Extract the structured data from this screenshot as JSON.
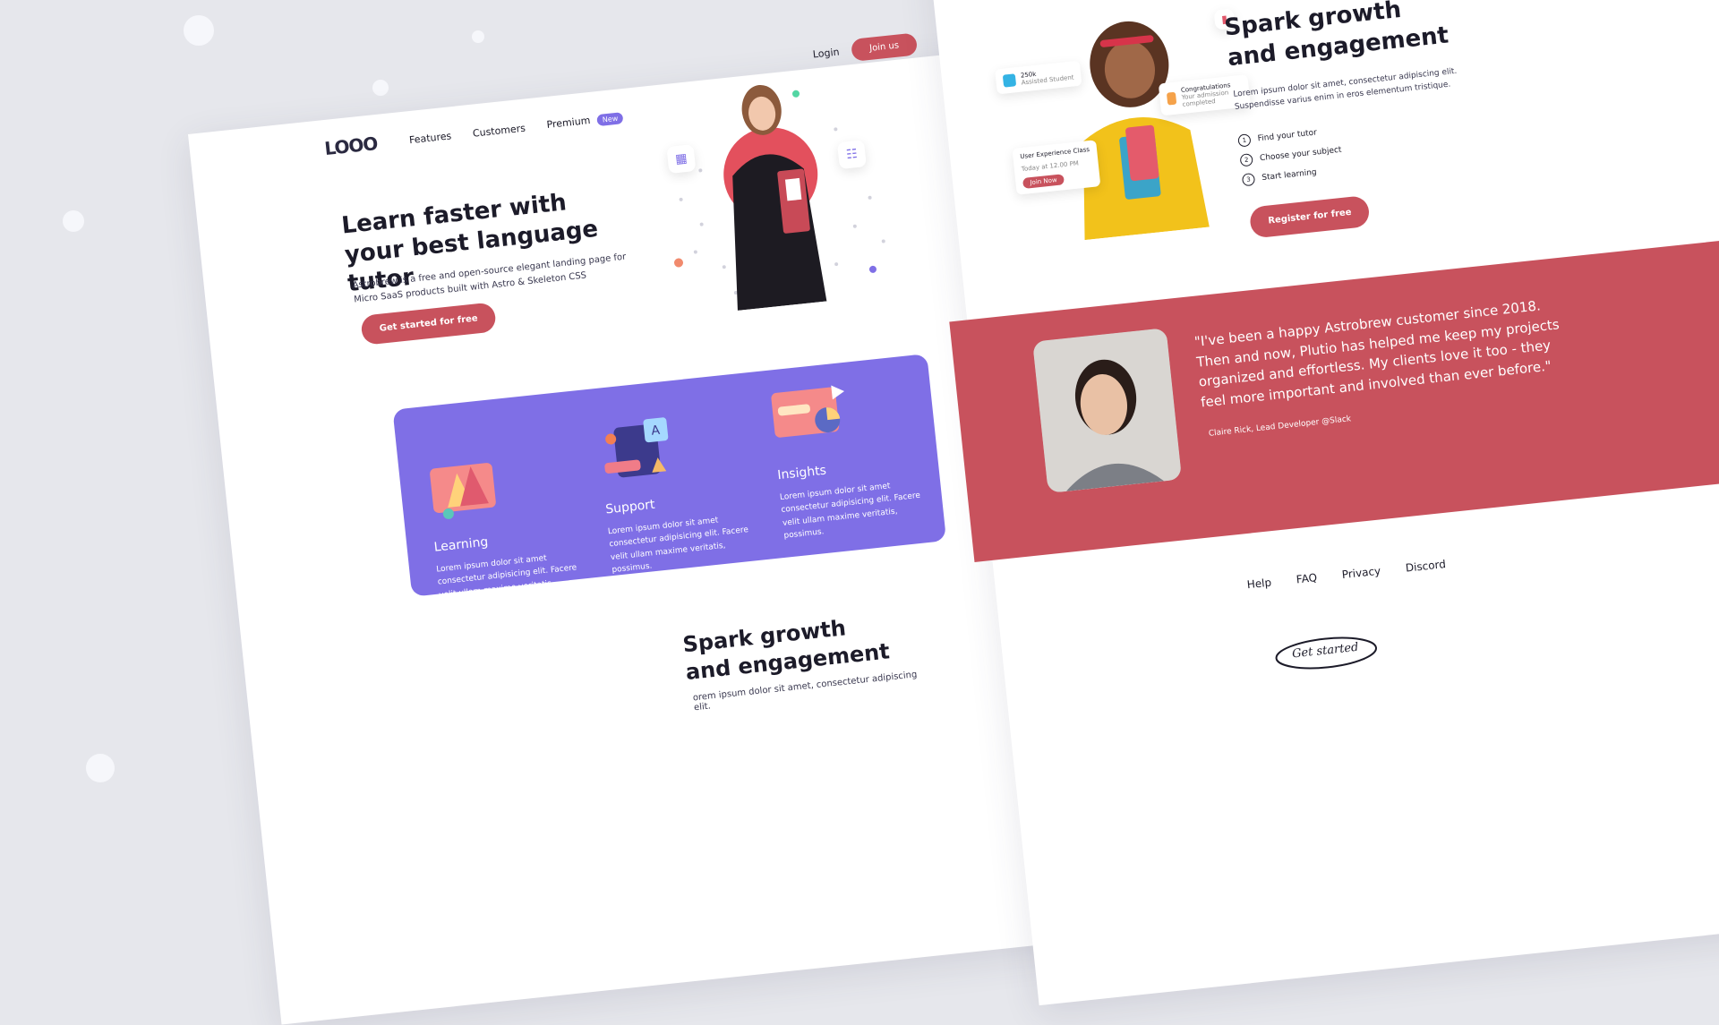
{
  "nav": {
    "logo": "LOOO",
    "features": "Features",
    "customers": "Customers",
    "premium": "Premium",
    "new_badge": "New",
    "login": "Login",
    "join": "Join us"
  },
  "hero": {
    "title": "Learn faster with your best language tutor",
    "description": "Astrobrew is a free and open-source elegant landing page for Micro SaaS products built with Astro & Skeleton CSS",
    "cta": "Get started for free"
  },
  "features": [
    {
      "title": "Learning",
      "desc": "Lorem ipsum dolor sit amet consectetur adipisicing elit. Facere velit ullam maxime veritatis, possimus."
    },
    {
      "title": "Support",
      "desc": "Lorem ipsum dolor sit amet consectetur adipisicing elit. Facere velit ullam maxime veritatis, possimus."
    },
    {
      "title": "Insights",
      "desc": "Lorem ipsum dolor sit amet consectetur adipisicing elit. Facere velit ullam maxime veritatis, possimus."
    }
  ],
  "spark": {
    "title": "Spark growth and engagement",
    "description": "Lorem ipsum dolor sit amet, consectetur adipiscing elit. Suspendisse varius enim in eros elementum tristique.",
    "steps": [
      "Find your tutor",
      "Choose your subject",
      "Start learning"
    ],
    "cta": "Register for free",
    "cards": {
      "stat_value": "250k",
      "stat_label": "Assisted Student",
      "congrats_title": "Congratulations",
      "congrats_sub": "Your admission completed",
      "class_title": "User Experience Class",
      "class_time": "Today at 12.00 PM",
      "class_btn": "Join Now"
    }
  },
  "spark_left": {
    "title": "Spark growth and engagement",
    "description_fragment": "orem ipsum dolor sit amet, consectetur adipiscing elit."
  },
  "testimonial": {
    "quote": "\"I've been a happy Astrobrew customer since 2018. Then and now, Plutio has helped me keep my projects organized and effortless. My clients love it too - they feel more important and involved than ever before.\"",
    "author": "Claire Rick, Lead Developer @Slack"
  },
  "footer": {
    "links": [
      "Help",
      "FAQ",
      "Privacy",
      "Discord"
    ],
    "get_started": "Get started"
  },
  "colors": {
    "accent_red": "#c8525d",
    "accent_purple": "#7f6fe6",
    "background": "#e6e7ec"
  }
}
